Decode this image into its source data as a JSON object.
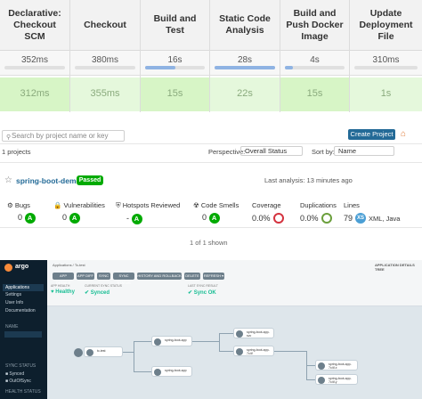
{
  "jenkins": {
    "stages": [
      {
        "name": "Declarative: Checkout SCM",
        "avg": "352ms",
        "avg_fill": 0,
        "run": "312ms"
      },
      {
        "name": "Checkout",
        "avg": "380ms",
        "avg_fill": 0,
        "run": "355ms"
      },
      {
        "name": "Build and Test",
        "avg": "16s",
        "avg_fill": 0.5,
        "run": "15s"
      },
      {
        "name": "Static Code Analysis",
        "avg": "28s",
        "avg_fill": 1.0,
        "run": "22s"
      },
      {
        "name": "Build and Push Docker Image",
        "avg": "4s",
        "avg_fill": 0.14,
        "run": "15s"
      },
      {
        "name": "Update Deployment File",
        "avg": "310ms",
        "avg_fill": 0,
        "run": "1s"
      }
    ]
  },
  "sonar": {
    "search_placeholder": "Search by project name or key",
    "create_project": "Create Project ▾",
    "projects_count": "1 projects",
    "perspective_label": "Perspective:",
    "perspective_value": "Overall Status",
    "sort_label": "Sort by:",
    "sort_value": "Name",
    "project": {
      "name": "spring-boot-demo",
      "status": "Passed",
      "last_analysis": "Last analysis: 13 minutes ago",
      "bugs_label": "Bugs",
      "bugs_value": "0",
      "bugs_grade": "A",
      "vuln_label": "Vulnerabilities",
      "vuln_value": "0",
      "vuln_grade": "A",
      "hotspots_label": "Hotspots Reviewed",
      "hotspots_value": "-",
      "hotspots_grade": "A",
      "smells_label": "Code Smells",
      "smells_value": "0",
      "smells_grade": "A",
      "coverage_label": "Coverage",
      "coverage_value": "0.0%",
      "dup_label": "Duplications",
      "dup_value": "0.0%",
      "lines_label": "Lines",
      "lines_value": "79",
      "size": "XS",
      "langs": "XML, Java"
    },
    "shown": "1 of 1 shown"
  },
  "argo": {
    "logo": "argo",
    "sidebar": [
      "Applications",
      "Settings",
      "User Info",
      "Documentation"
    ],
    "sidebar_sections": [
      "NAME",
      "SYNC STATUS",
      "HEALTH STATUS"
    ],
    "sidebar_filter": [
      "Synced",
      "OutOfSync"
    ],
    "breadcrumb": "Applications / Tc-test",
    "header_right": "APPLICATION DETAILS TREE",
    "buttons": [
      "APP DETAILS",
      "APP DIFF",
      "SYNC",
      "SYNC STATUS",
      "HISTORY AND ROLLBACK",
      "DELETE",
      "REFRESH ▾"
    ],
    "health": "Healthy",
    "app_health_label": "APP HEALTH",
    "current_sync_label": "CURRENT SYNC STATUS",
    "sync_status": "Synced",
    "last_sync_label": "LAST SYNC RESULT",
    "sync_ok": "Sync OK",
    "nodes": [
      "tc-test",
      "spring-boot-app",
      "spring-boot-app",
      "spring-boot-app-svc",
      "spring-boot-app-7c4f",
      "spring-boot-app-7c4f-x",
      "spring-boot-app-7c4f-y"
    ]
  }
}
